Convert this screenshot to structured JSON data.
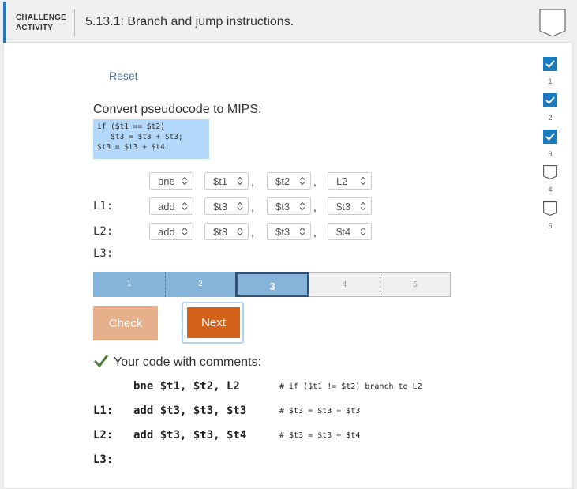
{
  "header": {
    "activity_label_line1": "CHALLENGE",
    "activity_label_line2": "ACTIVITY",
    "title": "5.13.1: Branch and jump instructions."
  },
  "reset_label": "Reset",
  "prompt": "Convert pseudocode to MIPS:",
  "pseudocode": "if ($t1 == $t2)\n   $t3 = $t3 + $t3;\n$t3 = $t3 + $t4;",
  "rows": [
    {
      "label": "",
      "op": "bne",
      "a1": "$t1",
      "a2": "$t2",
      "a3": "L2"
    },
    {
      "label": "L1:",
      "op": "add",
      "a1": "$t3",
      "a2": "$t3",
      "a3": "$t3"
    },
    {
      "label": "L2:",
      "op": "add",
      "a1": "$t3",
      "a2": "$t3",
      "a3": "$t4"
    },
    {
      "label": "L3:"
    }
  ],
  "comma": ",",
  "progress": {
    "segments": [
      "1",
      "2",
      "3",
      "4",
      "5"
    ],
    "current": 3
  },
  "buttons": {
    "check": "Check",
    "next": "Next"
  },
  "result_heading": "Your code with comments:",
  "result": [
    {
      "label": "",
      "code": "bne $t1, $t2, L2",
      "comment": "# if ($t1 != $t2) branch to L2"
    },
    {
      "label": "L1:",
      "code": "add $t3, $t3, $t3",
      "comment": "# $t3 = $t3 + $t3"
    },
    {
      "label": "L2:",
      "code": "add $t3, $t3, $t4",
      "comment": "# $t3 = $t3 + $t4"
    },
    {
      "label": "L3:",
      "code": "",
      "comment": ""
    }
  ],
  "levels": [
    {
      "num": "1",
      "done": true
    },
    {
      "num": "2",
      "done": true
    },
    {
      "num": "3",
      "done": true
    },
    {
      "num": "4",
      "done": false
    },
    {
      "num": "5",
      "done": false
    }
  ],
  "colors": {
    "accent": "#1a7bbf",
    "check_done": "#1a7bbf",
    "next_button": "#d4621b",
    "check_button": "#e6b08c",
    "progress_done": "#86b3d9",
    "success_check": "#4e7a37"
  }
}
